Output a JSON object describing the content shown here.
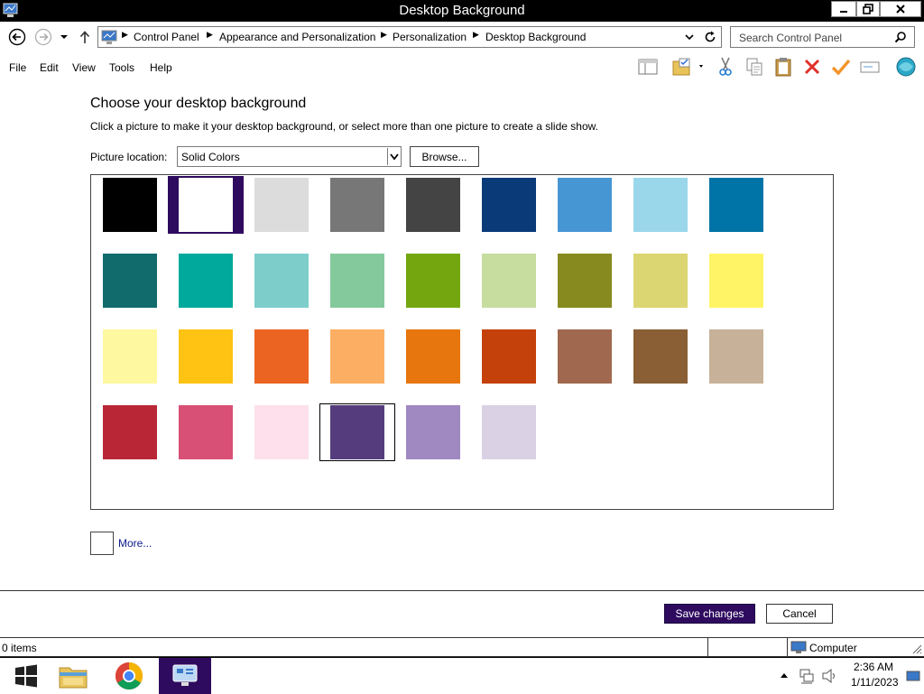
{
  "window": {
    "title": "Desktop Background"
  },
  "address": {
    "breadcrumbs": [
      "Control Panel",
      "Appearance and Personalization",
      "Personalization",
      "Desktop Background"
    ],
    "search_placeholder": "Search Control Panel"
  },
  "menu": [
    "File",
    "Edit",
    "View",
    "Tools",
    "Help"
  ],
  "content": {
    "heading": "Choose your desktop background",
    "subheading": "Click a picture to make it your desktop background, or select more than one picture to create a slide show.",
    "location_label": "Picture location:",
    "location_value": "Solid Colors",
    "browse_label": "Browse...",
    "more_label": "More...",
    "swatches": [
      [
        "#000000",
        "#ffffff",
        "#dcdcdc",
        "#777777",
        "#444444",
        "#0b3a78",
        "#4796d4",
        "#9ad7ea",
        "#0074a6"
      ],
      [
        "#116b6c",
        "#00a99b",
        "#7dcdcb",
        "#84c99c",
        "#74a70f",
        "#c6dd9f",
        "#878a1e",
        "#dbd672",
        "#fff466"
      ],
      [
        "#fef8a0",
        "#fec313",
        "#eb6421",
        "#fcae62",
        "#e6760d",
        "#c4410b",
        "#a0694f",
        "#8a5f35",
        "#c7b198"
      ],
      [
        "#b92737",
        "#d95076",
        "#fde0ec",
        "#553d7d",
        "#a088c0",
        "#dad1e4"
      ]
    ],
    "selected_swatches": [
      "#ffffff",
      "#553d7d"
    ]
  },
  "actions": {
    "save_label": "Save changes",
    "cancel_label": "Cancel"
  },
  "status": {
    "items": "0 items",
    "location": "Computer"
  },
  "taskbar": {
    "time": "2:36 AM",
    "date": "1/11/2023"
  }
}
